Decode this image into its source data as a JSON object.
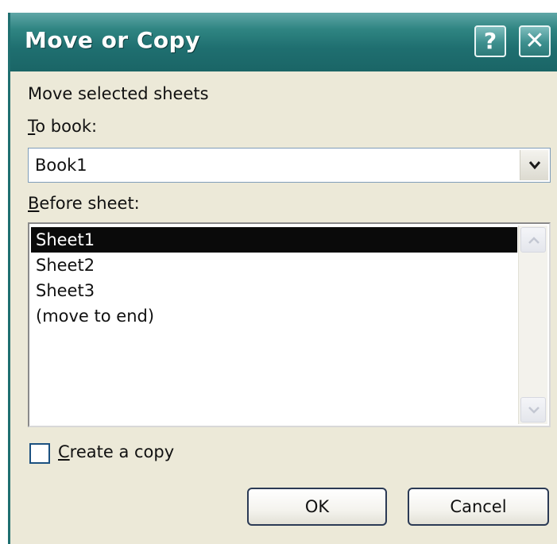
{
  "dialog": {
    "title": "Move or Copy",
    "help_button": "?",
    "close_button": "✕"
  },
  "header_text": "Move selected sheets",
  "to_book": {
    "label_accel": "T",
    "label_rest": "o book:",
    "value": "Book1"
  },
  "before_sheet": {
    "label_accel": "B",
    "label_rest": "efore sheet:",
    "items": [
      "Sheet1",
      "Sheet2",
      "Sheet3",
      "(move to end)"
    ],
    "selected_index": 0
  },
  "create_copy": {
    "label_accel": "C",
    "label_rest": "reate a copy",
    "checked": false
  },
  "buttons": {
    "ok": "OK",
    "cancel": "Cancel"
  },
  "colors": {
    "titlebar": "#1f6f70",
    "dialog_bg": "#ece9d8",
    "selection": "#0a0a0a"
  },
  "icons": [
    "help-icon",
    "close-icon",
    "chevron-down-icon",
    "scroll-up-icon",
    "scroll-down-icon"
  ]
}
